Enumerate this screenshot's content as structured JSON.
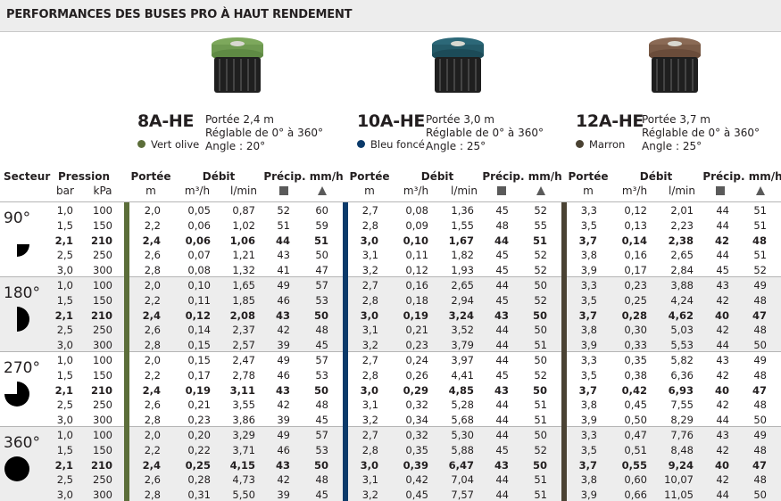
{
  "title": "PERFORMANCES DES BUSES PRO À HAUT RENDEMENT",
  "models": [
    {
      "name": "8A-HE",
      "color_name": "Vert olive",
      "color_hex": "#5c6e3a",
      "cap_color": "#7da85c",
      "specs": [
        "Portée 2,4 m",
        "Réglable de 0° à 360°",
        "Angle : 20°"
      ]
    },
    {
      "name": "10A-HE",
      "color_name": "Bleu foncé",
      "color_hex": "#0b3a6a",
      "cap_color": "#2c6878",
      "specs": [
        "Portée 3,0 m",
        "Réglable de 0° à 360°",
        "Angle : 25°"
      ]
    },
    {
      "name": "12A-HE",
      "color_name": "Marron",
      "color_hex": "#4a4233",
      "cap_color": "#8a6a55",
      "specs": [
        "Portée 3,7 m",
        "Réglable de 0° à 360°",
        "Angle : 25°"
      ]
    }
  ],
  "headers": {
    "secteur": "Secteur",
    "pression": "Pression",
    "bar": "bar",
    "kpa": "kPa",
    "portee": "Portée",
    "m": "m",
    "debit": "Débit",
    "m3h": "m³/h",
    "lmin": "l/min",
    "precip": "Précip. mm/h"
  },
  "sectors": [
    {
      "label": "90°",
      "shape": "quarter"
    },
    {
      "label": "180°",
      "shape": "half"
    },
    {
      "label": "270°",
      "shape": "three-quarter"
    },
    {
      "label": "360°",
      "shape": "full"
    }
  ],
  "rows": [
    [
      "1,0",
      "100",
      "2,0",
      "0,05",
      "0,87",
      "52",
      "60",
      "2,7",
      "0,08",
      "1,36",
      "45",
      "52",
      "3,3",
      "0,12",
      "2,01",
      "44",
      "51"
    ],
    [
      "1,5",
      "150",
      "2,2",
      "0,06",
      "1,02",
      "51",
      "59",
      "2,8",
      "0,09",
      "1,55",
      "48",
      "55",
      "3,5",
      "0,13",
      "2,23",
      "44",
      "51"
    ],
    [
      "2,1",
      "210",
      "2,4",
      "0,06",
      "1,06",
      "44",
      "51",
      "3,0",
      "0,10",
      "1,67",
      "44",
      "51",
      "3,7",
      "0,14",
      "2,38",
      "42",
      "48"
    ],
    [
      "2,5",
      "250",
      "2,6",
      "0,07",
      "1,21",
      "43",
      "50",
      "3,1",
      "0,11",
      "1,82",
      "45",
      "52",
      "3,8",
      "0,16",
      "2,65",
      "44",
      "51"
    ],
    [
      "3,0",
      "300",
      "2,8",
      "0,08",
      "1,32",
      "41",
      "47",
      "3,2",
      "0,12",
      "1,93",
      "45",
      "52",
      "3,9",
      "0,17",
      "2,84",
      "45",
      "52"
    ],
    [
      "1,0",
      "100",
      "2,0",
      "0,10",
      "1,65",
      "49",
      "57",
      "2,7",
      "0,16",
      "2,65",
      "44",
      "50",
      "3,3",
      "0,23",
      "3,88",
      "43",
      "49"
    ],
    [
      "1,5",
      "150",
      "2,2",
      "0,11",
      "1,85",
      "46",
      "53",
      "2,8",
      "0,18",
      "2,94",
      "45",
      "52",
      "3,5",
      "0,25",
      "4,24",
      "42",
      "48"
    ],
    [
      "2,1",
      "210",
      "2,4",
      "0,12",
      "2,08",
      "43",
      "50",
      "3,0",
      "0,19",
      "3,24",
      "43",
      "50",
      "3,7",
      "0,28",
      "4,62",
      "40",
      "47"
    ],
    [
      "2,5",
      "250",
      "2,6",
      "0,14",
      "2,37",
      "42",
      "48",
      "3,1",
      "0,21",
      "3,52",
      "44",
      "50",
      "3,8",
      "0,30",
      "5,03",
      "42",
      "48"
    ],
    [
      "3,0",
      "300",
      "2,8",
      "0,15",
      "2,57",
      "39",
      "45",
      "3,2",
      "0,23",
      "3,79",
      "44",
      "51",
      "3,9",
      "0,33",
      "5,53",
      "44",
      "50"
    ],
    [
      "1,0",
      "100",
      "2,0",
      "0,15",
      "2,47",
      "49",
      "57",
      "2,7",
      "0,24",
      "3,97",
      "44",
      "50",
      "3,3",
      "0,35",
      "5,82",
      "43",
      "49"
    ],
    [
      "1,5",
      "150",
      "2,2",
      "0,17",
      "2,78",
      "46",
      "53",
      "2,8",
      "0,26",
      "4,41",
      "45",
      "52",
      "3,5",
      "0,38",
      "6,36",
      "42",
      "48"
    ],
    [
      "2,1",
      "210",
      "2,4",
      "0,19",
      "3,11",
      "43",
      "50",
      "3,0",
      "0,29",
      "4,85",
      "43",
      "50",
      "3,7",
      "0,42",
      "6,93",
      "40",
      "47"
    ],
    [
      "2,5",
      "250",
      "2,6",
      "0,21",
      "3,55",
      "42",
      "48",
      "3,1",
      "0,32",
      "5,28",
      "44",
      "51",
      "3,8",
      "0,45",
      "7,55",
      "42",
      "48"
    ],
    [
      "3,0",
      "300",
      "2,8",
      "0,23",
      "3,86",
      "39",
      "45",
      "3,2",
      "0,34",
      "5,68",
      "44",
      "51",
      "3,9",
      "0,50",
      "8,29",
      "44",
      "50"
    ],
    [
      "1,0",
      "100",
      "2,0",
      "0,20",
      "3,29",
      "49",
      "57",
      "2,7",
      "0,32",
      "5,30",
      "44",
      "50",
      "3,3",
      "0,47",
      "7,76",
      "43",
      "49"
    ],
    [
      "1,5",
      "150",
      "2,2",
      "0,22",
      "3,71",
      "46",
      "53",
      "2,8",
      "0,35",
      "5,88",
      "45",
      "52",
      "3,5",
      "0,51",
      "8,48",
      "42",
      "48"
    ],
    [
      "2,1",
      "210",
      "2,4",
      "0,25",
      "4,15",
      "43",
      "50",
      "3,0",
      "0,39",
      "6,47",
      "43",
      "50",
      "3,7",
      "0,55",
      "9,24",
      "40",
      "47"
    ],
    [
      "2,5",
      "250",
      "2,6",
      "0,28",
      "4,73",
      "42",
      "48",
      "3,1",
      "0,42",
      "7,04",
      "44",
      "51",
      "3,8",
      "0,60",
      "10,07",
      "42",
      "48"
    ],
    [
      "3,0",
      "300",
      "2,8",
      "0,31",
      "5,50",
      "39",
      "45",
      "3,2",
      "0,45",
      "7,57",
      "44",
      "51",
      "3,9",
      "0,66",
      "11,05",
      "44",
      "50"
    ]
  ]
}
